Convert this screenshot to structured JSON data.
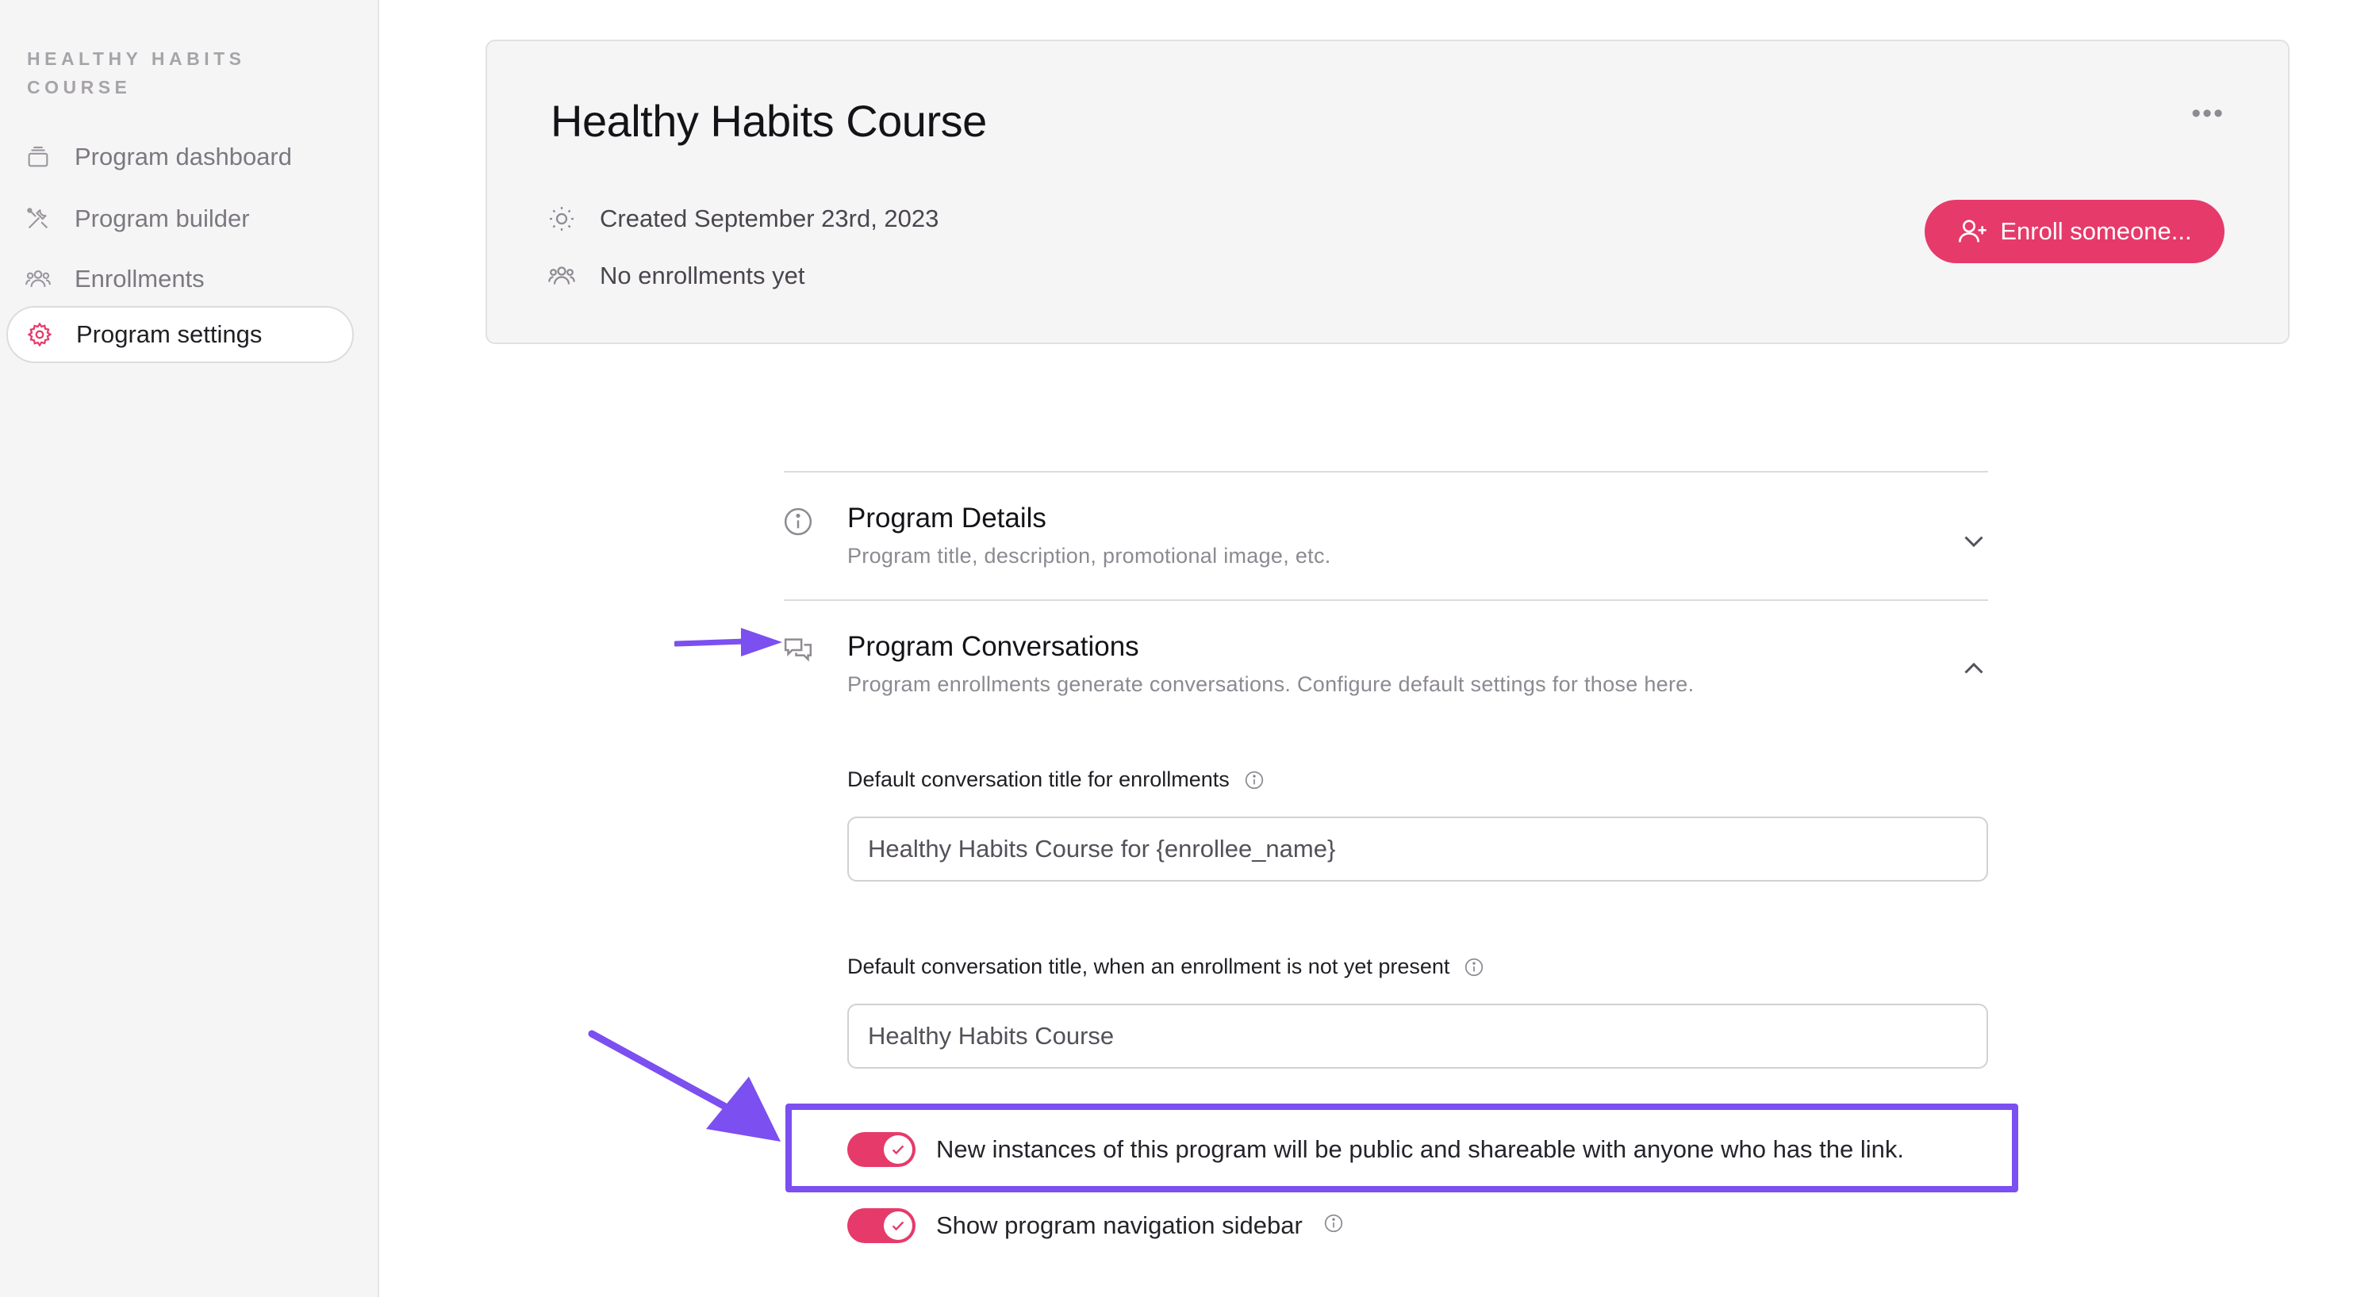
{
  "sidebar": {
    "brand": "HEALTHY HABITS COURSE",
    "items": [
      {
        "label": "Program dashboard",
        "icon": "layers-icon"
      },
      {
        "label": "Program builder",
        "icon": "tools-icon"
      },
      {
        "label": "Enrollments",
        "icon": "people-icon"
      },
      {
        "label": "Program settings",
        "icon": "gear-icon",
        "active": true
      }
    ]
  },
  "header": {
    "title": "Healthy Habits Course",
    "more_icon": "more-horizontal-icon",
    "created": "Created September 23rd, 2023",
    "enrollments": "No enrollments yet",
    "enroll_button": "Enroll someone..."
  },
  "sections": {
    "details": {
      "title": "Program Details",
      "subtitle": "Program title, description, promotional image, etc."
    },
    "conversations": {
      "title": "Program Conversations",
      "subtitle": "Program enrollments generate conversations. Configure default settings for those here."
    }
  },
  "fields": {
    "title_label": "Default conversation title for enrollments",
    "title_value": "Healthy Habits Course for {enrollee_name}",
    "fallback_label": "Default conversation title, when an enrollment is not yet present",
    "fallback_value": "Healthy Habits Course"
  },
  "toggles": {
    "public_label": "New instances of this program will be public and shareable with anyone who has the link.",
    "public_on": true,
    "sidebar_label": "Show program navigation sidebar",
    "sidebar_on": true
  },
  "colors": {
    "accent": "#e63a6a",
    "annotation": "#7b4ff0",
    "sidebar_bg": "#f6f5f6"
  }
}
